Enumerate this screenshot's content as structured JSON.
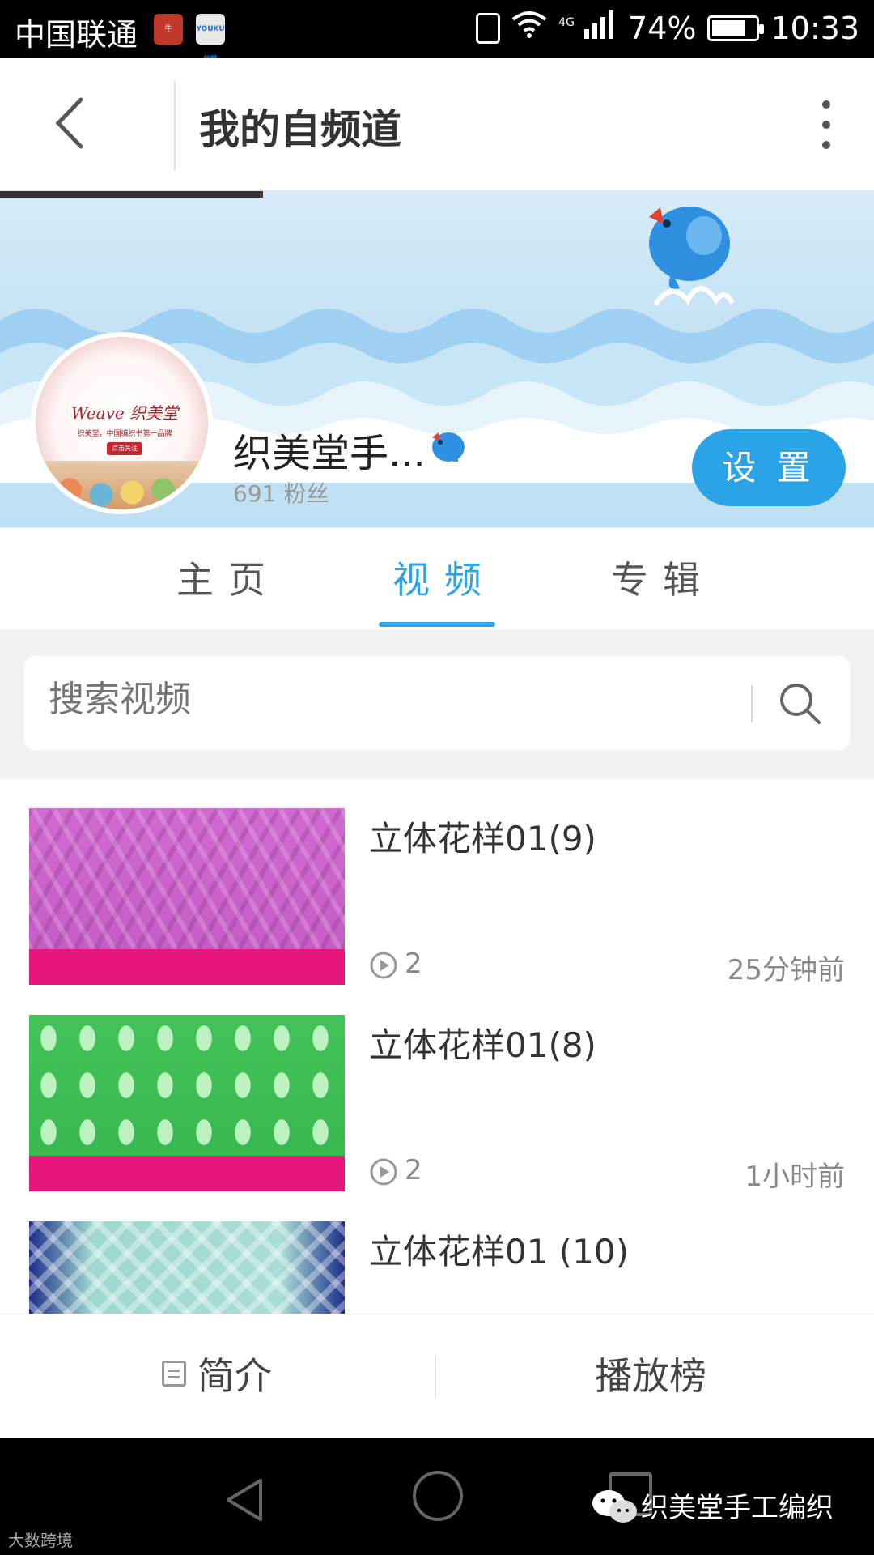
{
  "status_bar": {
    "carrier": "中国联通",
    "network": "4G",
    "battery": "74%",
    "time": "10:33",
    "app1_label": "",
    "app2_label": "YOUKU 优酷"
  },
  "header": {
    "title": "我的自频道"
  },
  "profile": {
    "avatar_logo_text": "Weave 织美堂",
    "avatar_sub_text": "织美堂，中国编织书第一品牌",
    "avatar_button_text": "点击关注",
    "channel_name": "织美堂手...",
    "fans": "691 粉丝",
    "settings_label": "设 置"
  },
  "tabs": [
    {
      "label": "主页",
      "active": false
    },
    {
      "label": "视频",
      "active": true
    },
    {
      "label": "专辑",
      "active": false
    }
  ],
  "search": {
    "placeholder": "搜索视频"
  },
  "videos": [
    {
      "title": "立体花样01(9)",
      "plays": "2",
      "time": "25分钟前"
    },
    {
      "title": "立体花样01(8)",
      "plays": "2",
      "time": "1小时前"
    },
    {
      "title": "立体花样01 (10)",
      "plays": "",
      "time": ""
    }
  ],
  "action_bar": {
    "intro_label": "简介",
    "rank_label": "播放榜"
  },
  "watermark": {
    "text": "织美堂手工编织",
    "left_text": "大数跨境"
  },
  "colors": {
    "accent": "#2aa4e6",
    "status_bar": "#000000"
  }
}
